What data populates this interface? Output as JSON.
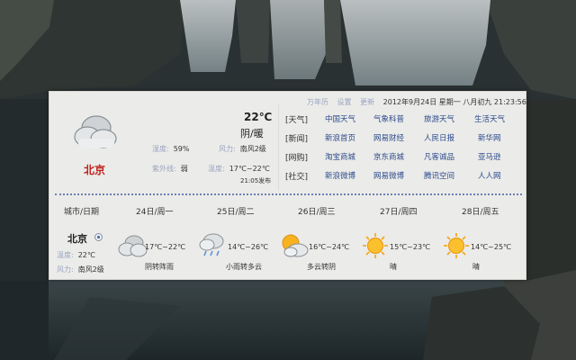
{
  "colors": {
    "accent_red": "#c0221e",
    "link_blue": "#2b4a8c",
    "muted_label": "#9aa4c0",
    "separator": "#6d7fb6"
  },
  "topbar": {
    "links": [
      "万年历",
      "设置",
      "更新"
    ],
    "datetime": "2012年9月24日 星期一 八月初九 21:23:56"
  },
  "current": {
    "icon": "cloudy-icon",
    "city": "北京",
    "temp": "22℃",
    "condition": "阴/暖",
    "humidity_label": "湿度:",
    "humidity": "59%",
    "wind_label": "风力:",
    "wind": "南风2级",
    "uv_label": "紫外线:",
    "uv": "弱",
    "range_label": "温度:",
    "range": "17℃~22℃",
    "published": "21:05发布"
  },
  "links": [
    {
      "cat": "[天气]",
      "items": [
        "中国天气",
        "气象科普",
        "旅游天气",
        "生活天气"
      ]
    },
    {
      "cat": "[新闻]",
      "items": [
        "新浪首页",
        "网易财经",
        "人民日报",
        "新华网"
      ]
    },
    {
      "cat": "[网购]",
      "items": [
        "淘宝商城",
        "京东商城",
        "凡客诚品",
        "亚马逊"
      ]
    },
    {
      "cat": "[社交]",
      "items": [
        "新浪微博",
        "网易微博",
        "腾讯空间",
        "人人网"
      ]
    }
  ],
  "forecast_header": {
    "city_date": "城市/日期",
    "days": [
      "24日/周一",
      "25日/周二",
      "26日/周三",
      "27日/周四",
      "28日/周五"
    ]
  },
  "mini": {
    "city": "北京",
    "temp_label": "温度:",
    "temp": "22℃",
    "wind_label": "风力:",
    "wind": "南风2级"
  },
  "forecast": [
    {
      "icon": "cloudy-icon",
      "range": "17℃~22℃",
      "desc": "阴转阵雨"
    },
    {
      "icon": "light-rain-icon",
      "range": "14℃~26℃",
      "desc": "小雨转多云"
    },
    {
      "icon": "partly-cloudy-icon",
      "range": "16℃~24℃",
      "desc": "多云转阴"
    },
    {
      "icon": "sunny-icon",
      "range": "15℃~23℃",
      "desc": "晴"
    },
    {
      "icon": "sunny-icon",
      "range": "14℃~25℃",
      "desc": "晴"
    }
  ]
}
